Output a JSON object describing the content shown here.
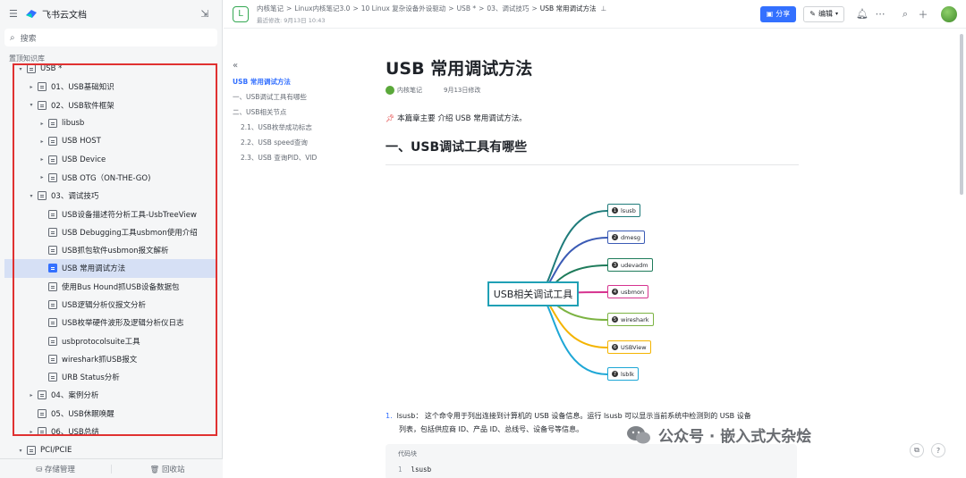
{
  "app": {
    "brand": "飞书云文档",
    "search_label": "搜索",
    "section_label": "置顶知识库"
  },
  "tree": {
    "items": [
      {
        "label": "USB *",
        "indent": 0,
        "arrow": "▾",
        "active": false
      },
      {
        "label": "01、USB基础知识",
        "indent": 1,
        "arrow": "▸",
        "active": false
      },
      {
        "label": "02、USB软件框架",
        "indent": 1,
        "arrow": "▾",
        "active": false
      },
      {
        "label": "libusb",
        "indent": 2,
        "arrow": "▸",
        "active": false
      },
      {
        "label": "USB HOST",
        "indent": 2,
        "arrow": "▸",
        "active": false
      },
      {
        "label": "USB Device",
        "indent": 2,
        "arrow": "▸",
        "active": false
      },
      {
        "label": "USB OTG（ON-THE-GO)",
        "indent": 2,
        "arrow": "▸",
        "active": false
      },
      {
        "label": "03、调试技巧",
        "indent": 1,
        "arrow": "▾",
        "active": false
      },
      {
        "label": "USB设备描述符分析工具-UsbTreeView",
        "indent": 2,
        "arrow": "",
        "active": false
      },
      {
        "label": "USB Debugging工具usbmon使用介绍",
        "indent": 2,
        "arrow": "",
        "active": false
      },
      {
        "label": "USB抓包软件usbmon报文解析",
        "indent": 2,
        "arrow": "",
        "active": false
      },
      {
        "label": "USB 常用调试方法",
        "indent": 2,
        "arrow": "",
        "active": true
      },
      {
        "label": "使用Bus Hound抓USB设备数据包",
        "indent": 2,
        "arrow": "",
        "active": false
      },
      {
        "label": "USB逻辑分析仪报文分析",
        "indent": 2,
        "arrow": "",
        "active": false
      },
      {
        "label": "USB枚举硬件波形及逻辑分析仪日志",
        "indent": 2,
        "arrow": "",
        "active": false
      },
      {
        "label": "usbprotocolsuite工具",
        "indent": 2,
        "arrow": "",
        "active": false
      },
      {
        "label": "wireshark抓USB报文",
        "indent": 2,
        "arrow": "",
        "active": false
      },
      {
        "label": "URB Status分析",
        "indent": 2,
        "arrow": "",
        "active": false
      },
      {
        "label": "04、案例分析",
        "indent": 1,
        "arrow": "▸",
        "active": false
      },
      {
        "label": "05、USB休眠唤醒",
        "indent": 1,
        "arrow": "",
        "active": false
      },
      {
        "label": "06、USB总结",
        "indent": 1,
        "arrow": "▸",
        "active": false
      }
    ],
    "pci_label": "PCI/PCIE"
  },
  "sidebar_bottom": {
    "storage": "存储管理",
    "recycle": "回收站"
  },
  "header": {
    "workspace_icon": "L",
    "crumbs": [
      "内核笔记",
      "Linux内核笔记3.0",
      "10 Linux 复杂设备外设驱动",
      "USB *",
      "03、调试技巧"
    ],
    "current": "USB 常用调试方法",
    "last_modified": "最近修改: 9月13日 10:43",
    "share_label": "分享",
    "edit_label": "编辑"
  },
  "toc": {
    "items": [
      {
        "label": "USB 常用调试方法",
        "level": 0,
        "active": true
      },
      {
        "label": "一、USB调试工具有哪些",
        "level": 1,
        "active": false
      },
      {
        "label": "二、USB相关节点",
        "level": 1,
        "active": false
      },
      {
        "label": "2.1、USB枚举成功标志",
        "level": 2,
        "active": false
      },
      {
        "label": "2.2、USB speed查询",
        "level": 2,
        "active": false
      },
      {
        "label": "2.3、USB 查询PID、VID",
        "level": 2,
        "active": false
      }
    ]
  },
  "document": {
    "title": "USB 常用调试方法",
    "author": "内核笔记",
    "modified": "9月13日修改",
    "intro": "本篇章主要 介绍 USB 常用调试方法。",
    "h1": "一、USB调试工具有哪些",
    "mindmap": {
      "center": "USB相关调试工具",
      "nodes": [
        {
          "num": "1",
          "label": "lsusb",
          "color": "#1e7b7a"
        },
        {
          "num": "2",
          "label": "dmesg",
          "color": "#3b5bb5"
        },
        {
          "num": "3",
          "label": "udevadm",
          "color": "#1e7b5a"
        },
        {
          "num": "4",
          "label": "usbmon",
          "color": "#d6338f"
        },
        {
          "num": "5",
          "label": "wireshark",
          "color": "#7cb342"
        },
        {
          "num": "6",
          "label": "USBView",
          "color": "#f4b400"
        },
        {
          "num": "7",
          "label": "lsblk",
          "color": "#1ea7d6"
        }
      ]
    },
    "list_num": "1.",
    "list_text_1": "lsusb： 这个命令用于列出连接到计算机的 USB 设备信息。运行 lsusb 可以显示当前系统中检测到的 USB 设备",
    "list_text_2": "列表，包括供应商 ID、产品 ID、总线号、设备号等信息。",
    "code_label": "代码块",
    "code_line_no": "1",
    "code_line": "lsusb"
  },
  "watermark": "公众号 · 嵌入式大杂烩"
}
